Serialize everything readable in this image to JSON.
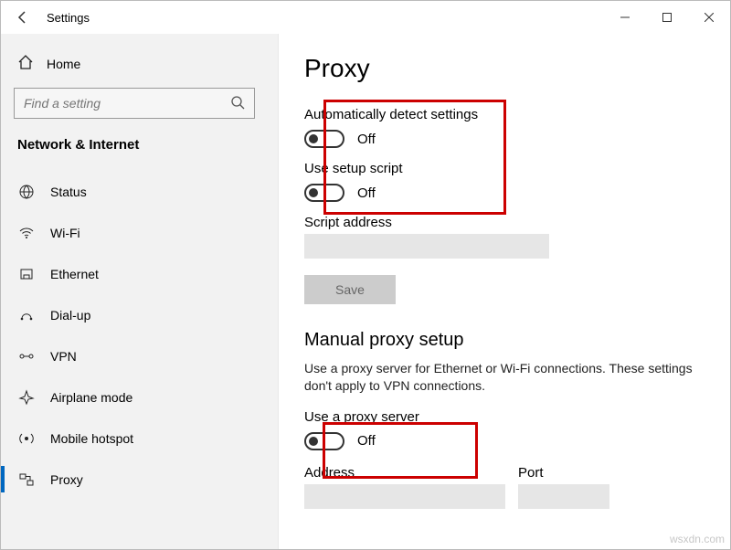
{
  "titlebar": {
    "back": "←",
    "title": "Settings"
  },
  "sidebar": {
    "home": "Home",
    "search_placeholder": "Find a setting",
    "section": "Network & Internet",
    "items": [
      {
        "label": "Status"
      },
      {
        "label": "Wi-Fi"
      },
      {
        "label": "Ethernet"
      },
      {
        "label": "Dial-up"
      },
      {
        "label": "VPN"
      },
      {
        "label": "Airplane mode"
      },
      {
        "label": "Mobile hotspot"
      },
      {
        "label": "Proxy"
      }
    ]
  },
  "main": {
    "heading": "Proxy",
    "auto_detect_label": "Automatically detect settings",
    "auto_detect_state": "Off",
    "setup_script_label": "Use setup script",
    "setup_script_state": "Off",
    "script_address_label": "Script address",
    "script_address_value": "",
    "save_label": "Save",
    "manual_heading": "Manual proxy setup",
    "manual_desc": "Use a proxy server for Ethernet or Wi-Fi connections. These settings don't apply to VPN connections.",
    "use_proxy_label": "Use a proxy server",
    "use_proxy_state": "Off",
    "address_label": "Address",
    "address_value": "",
    "port_label": "Port",
    "port_value": ""
  },
  "watermark": "wsxdn.com"
}
